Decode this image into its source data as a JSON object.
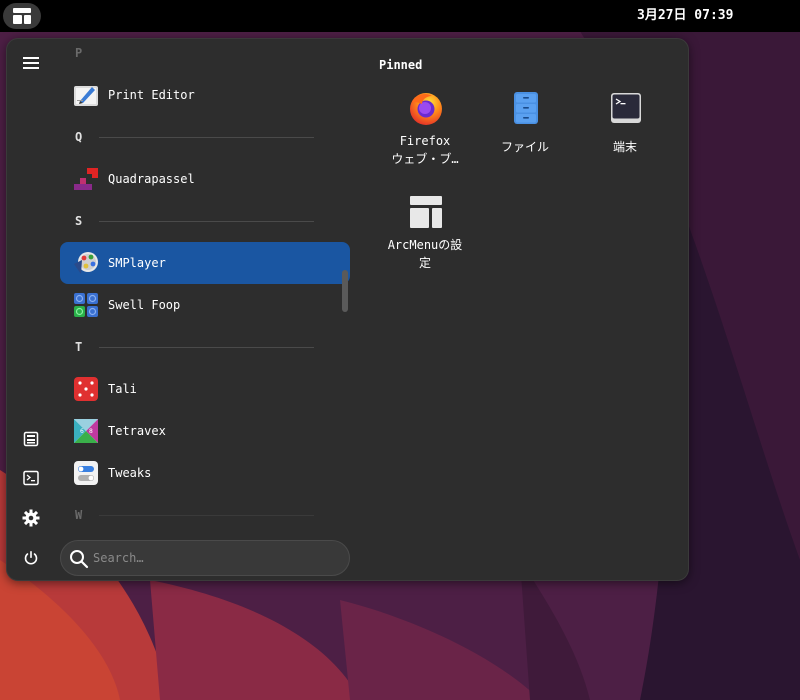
{
  "topbar": {
    "clock": "3月27日 07:39"
  },
  "sidebar": {
    "icons": [
      "menu-icon",
      "file-manager-icon",
      "terminal-icon",
      "settings-icon",
      "power-icon"
    ]
  },
  "app_list": {
    "sections": [
      {
        "letter": "P",
        "apps": [
          "Print Editor"
        ]
      },
      {
        "letter": "Q",
        "apps": [
          "Quadrapassel"
        ]
      },
      {
        "letter": "S",
        "apps": [
          "SMPlayer",
          "Swell Foop"
        ]
      },
      {
        "letter": "T",
        "apps": [
          "Tali",
          "Tetravex",
          "Tweaks"
        ]
      },
      {
        "letter": "W",
        "apps": []
      }
    ],
    "selected": "SMPlayer"
  },
  "search": {
    "placeholder": "Search…",
    "value": ""
  },
  "pinned": {
    "title": "Pinned",
    "items": [
      {
        "label": "Firefox ウェブ・ブ…",
        "line1": "Firefox",
        "line2": "ウェブ・ブ…"
      },
      {
        "label": "ファイル"
      },
      {
        "label": "端末"
      },
      {
        "label": "ArcMenuの設定",
        "line1": "ArcMenuの設",
        "line2": "定"
      }
    ]
  },
  "colors": {
    "selection": "#1a56a2",
    "panel": "#2d2d2d",
    "topbar": "#000000"
  }
}
